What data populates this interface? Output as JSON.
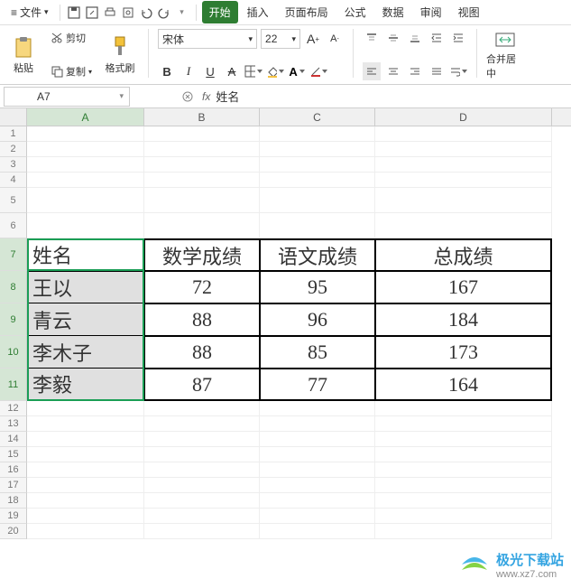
{
  "menu": {
    "file": "文件",
    "tabs": [
      "开始",
      "插入",
      "页面布局",
      "公式",
      "数据",
      "审阅",
      "视图"
    ]
  },
  "ribbon": {
    "paste": "粘贴",
    "cut": "剪切",
    "copy": "复制",
    "format_painter": "格式刷",
    "font_name": "宋体",
    "font_size": "22",
    "merge": "合并居中"
  },
  "namebox": "A7",
  "formula_value": "姓名",
  "columns": [
    "A",
    "B",
    "C",
    "D"
  ],
  "rows": [
    1,
    2,
    3,
    4,
    5,
    6,
    7,
    8,
    9,
    10,
    11,
    12,
    13,
    14,
    15,
    16,
    17,
    18,
    19,
    20
  ],
  "chart_data": {
    "type": "table",
    "headers": [
      "姓名",
      "数学成绩",
      "语文成绩",
      "总成绩"
    ],
    "rows": [
      {
        "name": "王以",
        "math": 72,
        "chinese": 95,
        "total": 167
      },
      {
        "name": "青云",
        "math": 88,
        "chinese": 96,
        "total": 184
      },
      {
        "name": "李木子",
        "math": 88,
        "chinese": 85,
        "total": 173
      },
      {
        "name": "李毅",
        "math": 87,
        "chinese": 77,
        "total": 164
      }
    ]
  },
  "watermark": {
    "name": "极光下载站",
    "url": "www.xz7.com"
  }
}
